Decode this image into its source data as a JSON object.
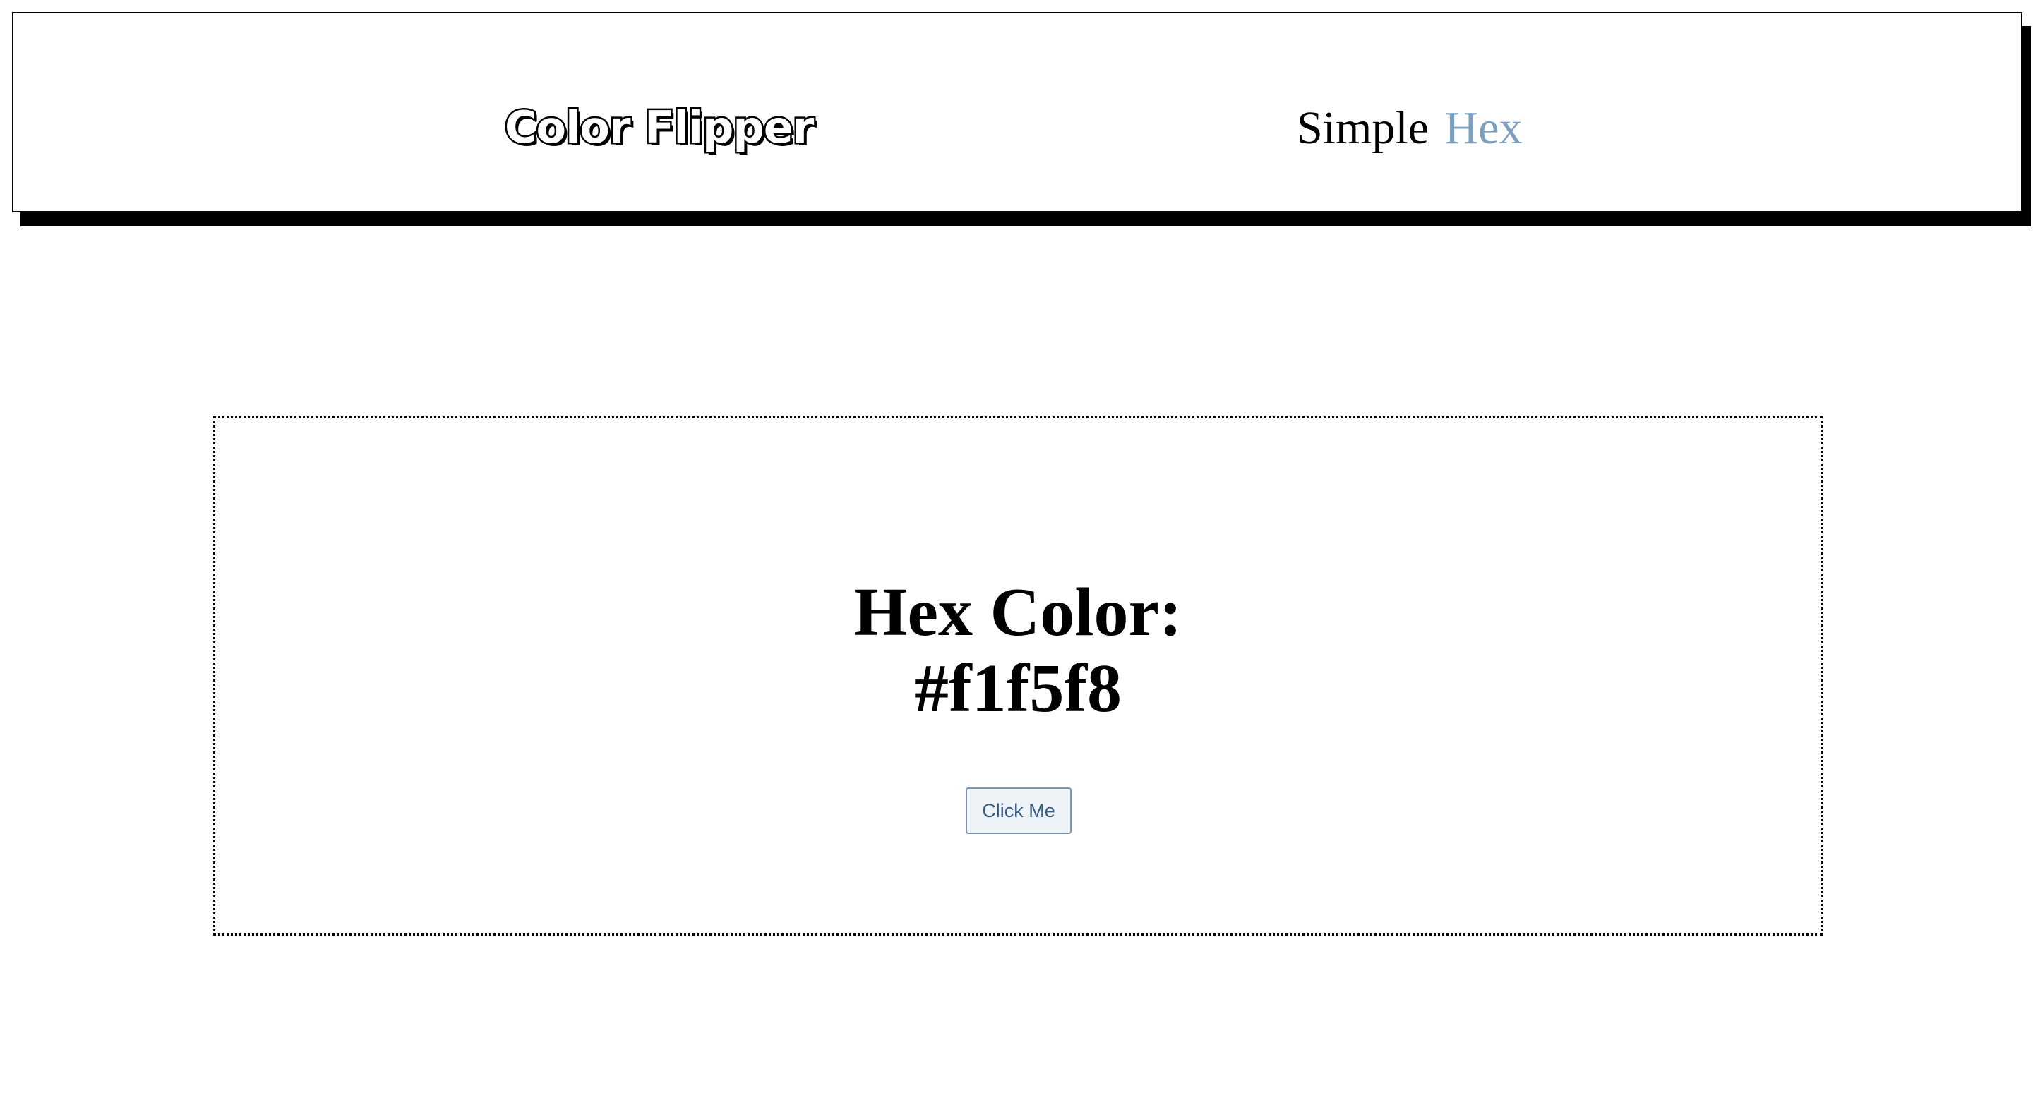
{
  "navbar": {
    "logo_text": "Color Flipper",
    "links": [
      {
        "label": "Simple"
      },
      {
        "label": "Hex"
      }
    ],
    "colors": {
      "link_default": "#000000",
      "link_active": "#7c9fc0"
    }
  },
  "main": {
    "heading_label": "Hex Color:",
    "color_value": "#f1f5f8",
    "button_label": "Click Me"
  },
  "colors": {
    "background": "#ffffff",
    "button_background": "#eef3f8",
    "button_border": "#7a98b6",
    "button_text": "#375d86"
  }
}
